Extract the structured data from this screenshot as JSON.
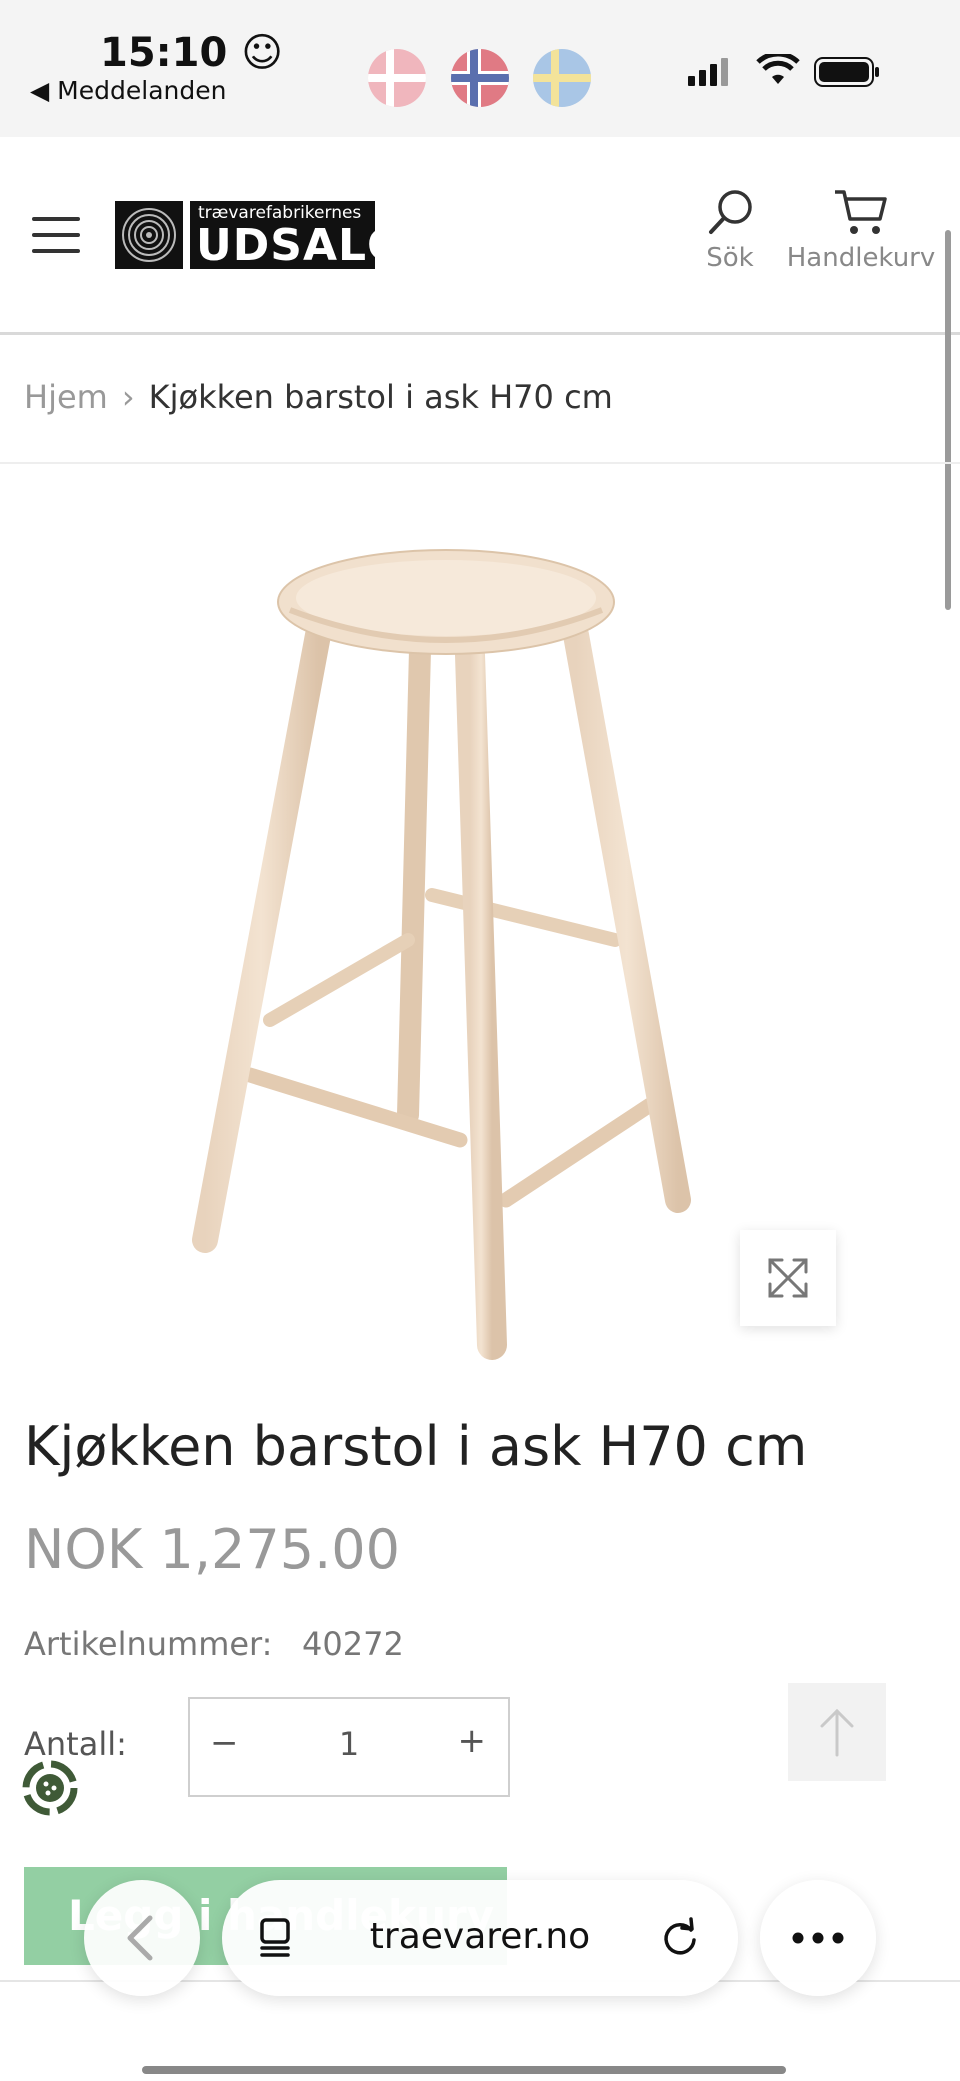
{
  "status_bar": {
    "time": "15:10 ☺",
    "back_label": "◀ Meddelanden"
  },
  "header": {
    "logo_small": "trævarefabrikernes",
    "logo_big": "UDSALG",
    "search_label": "Sök",
    "cart_label": "Handlekurv"
  },
  "breadcrumb": {
    "home": "Hjem",
    "separator": "›",
    "current": "Kjøkken barstol i ask H70 cm"
  },
  "product": {
    "title": "Kjøkken barstol i ask H70 cm",
    "price": "NOK 1,275.00",
    "sku_label": "Artikelnummer:",
    "sku_value": "40272",
    "qty_label": "Antall:",
    "qty_minus": "−",
    "qty_value": "1",
    "qty_plus": "+",
    "add_to_cart": "Legg i handlekurv"
  },
  "browser": {
    "url": "traevarer.no"
  },
  "colors": {
    "accent_green": "#6fbf85",
    "price_gray": "#999999"
  }
}
